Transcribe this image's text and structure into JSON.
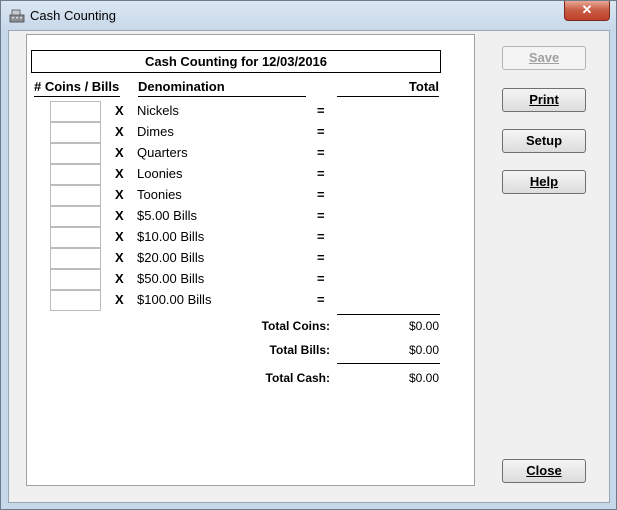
{
  "window": {
    "title": "Cash Counting"
  },
  "panel": {
    "heading": "Cash Counting for 12/03/2016",
    "headers": {
      "count": "# Coins / Bills",
      "denomination": "Denomination",
      "total": "Total"
    },
    "multiply_symbol": "X",
    "equals_symbol": "=",
    "rows": [
      {
        "label": "Nickels",
        "count": ""
      },
      {
        "label": "Dimes",
        "count": ""
      },
      {
        "label": "Quarters",
        "count": ""
      },
      {
        "label": "Loonies",
        "count": ""
      },
      {
        "label": "Toonies",
        "count": ""
      },
      {
        "label": "$5.00 Bills",
        "count": ""
      },
      {
        "label": "$10.00 Bills",
        "count": ""
      },
      {
        "label": "$20.00 Bills",
        "count": ""
      },
      {
        "label": "$50.00 Bills",
        "count": ""
      },
      {
        "label": "$100.00 Bills",
        "count": ""
      }
    ],
    "summary": {
      "coins_label": "Total Coins:",
      "coins_value": "$0.00",
      "bills_label": "Total Bills:",
      "bills_value": "$0.00",
      "cash_label": "Total Cash:",
      "cash_value": "$0.00"
    }
  },
  "buttons": {
    "save": {
      "label": "Save",
      "enabled": false
    },
    "print": {
      "label": "Print"
    },
    "setup": {
      "label": "Setup"
    },
    "help": {
      "label": "Help"
    },
    "close": {
      "label": "Close"
    }
  }
}
